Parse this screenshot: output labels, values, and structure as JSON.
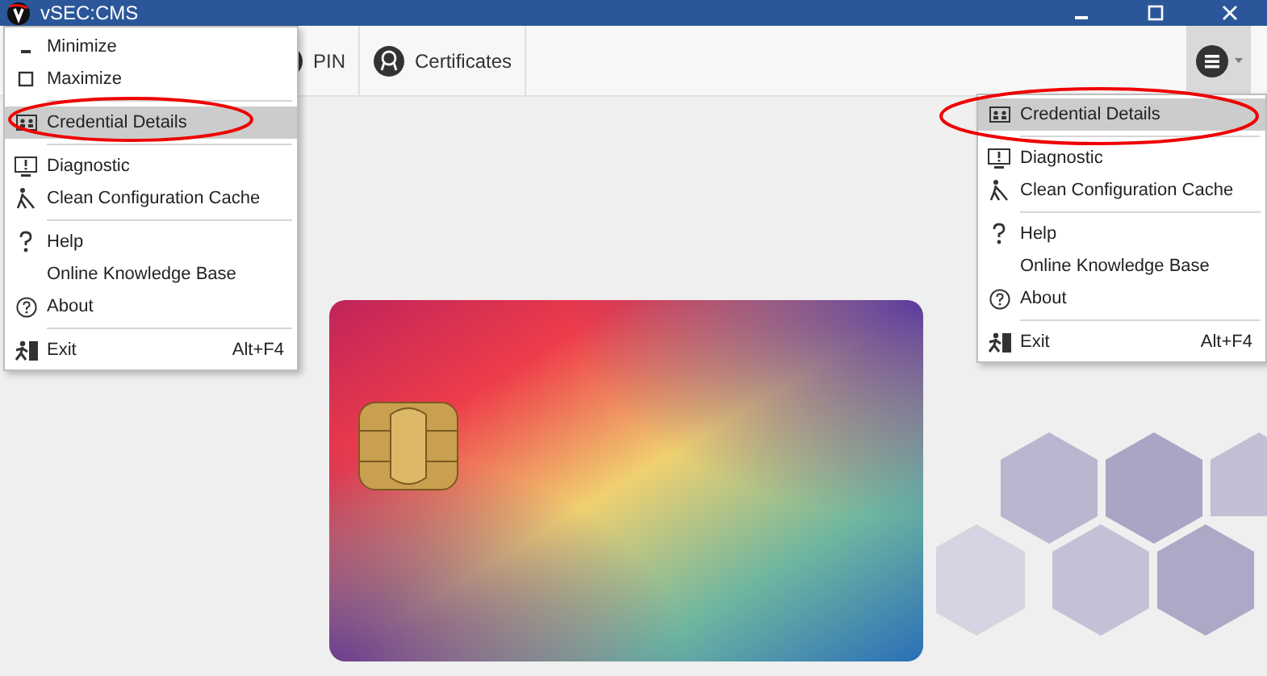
{
  "window": {
    "title": "vSEC:CMS"
  },
  "toolbar": {
    "buttons": [
      {
        "label": "PIN"
      },
      {
        "label": "Certificates"
      }
    ]
  },
  "system_menu": {
    "items": [
      {
        "kind": "item",
        "label": "Minimize",
        "selected": false
      },
      {
        "kind": "item",
        "label": "Maximize",
        "selected": false
      },
      {
        "kind": "separator"
      },
      {
        "kind": "item",
        "label": "Credential Details",
        "selected": true
      },
      {
        "kind": "separator"
      },
      {
        "kind": "item",
        "label": "Diagnostic",
        "selected": false
      },
      {
        "kind": "item",
        "label": "Clean Configuration Cache",
        "selected": false
      },
      {
        "kind": "separator"
      },
      {
        "kind": "item",
        "label": "Help",
        "selected": false
      },
      {
        "kind": "item",
        "label": "Online Knowledge Base",
        "selected": false
      },
      {
        "kind": "item",
        "label": "About",
        "selected": false
      },
      {
        "kind": "separator"
      },
      {
        "kind": "item",
        "label": "Exit",
        "shortcut": "Alt+F4",
        "selected": false
      }
    ]
  },
  "app_menu": {
    "items": [
      {
        "kind": "item",
        "label": "Credential Details",
        "selected": true
      },
      {
        "kind": "separator"
      },
      {
        "kind": "item",
        "label": "Diagnostic",
        "selected": false
      },
      {
        "kind": "item",
        "label": "Clean Configuration Cache",
        "selected": false
      },
      {
        "kind": "separator"
      },
      {
        "kind": "item",
        "label": "Help",
        "selected": false
      },
      {
        "kind": "item",
        "label": "Online Knowledge Base",
        "selected": false
      },
      {
        "kind": "item",
        "label": "About",
        "selected": false
      },
      {
        "kind": "separator"
      },
      {
        "kind": "item",
        "label": "Exit",
        "shortcut": "Alt+F4",
        "selected": false
      }
    ]
  }
}
